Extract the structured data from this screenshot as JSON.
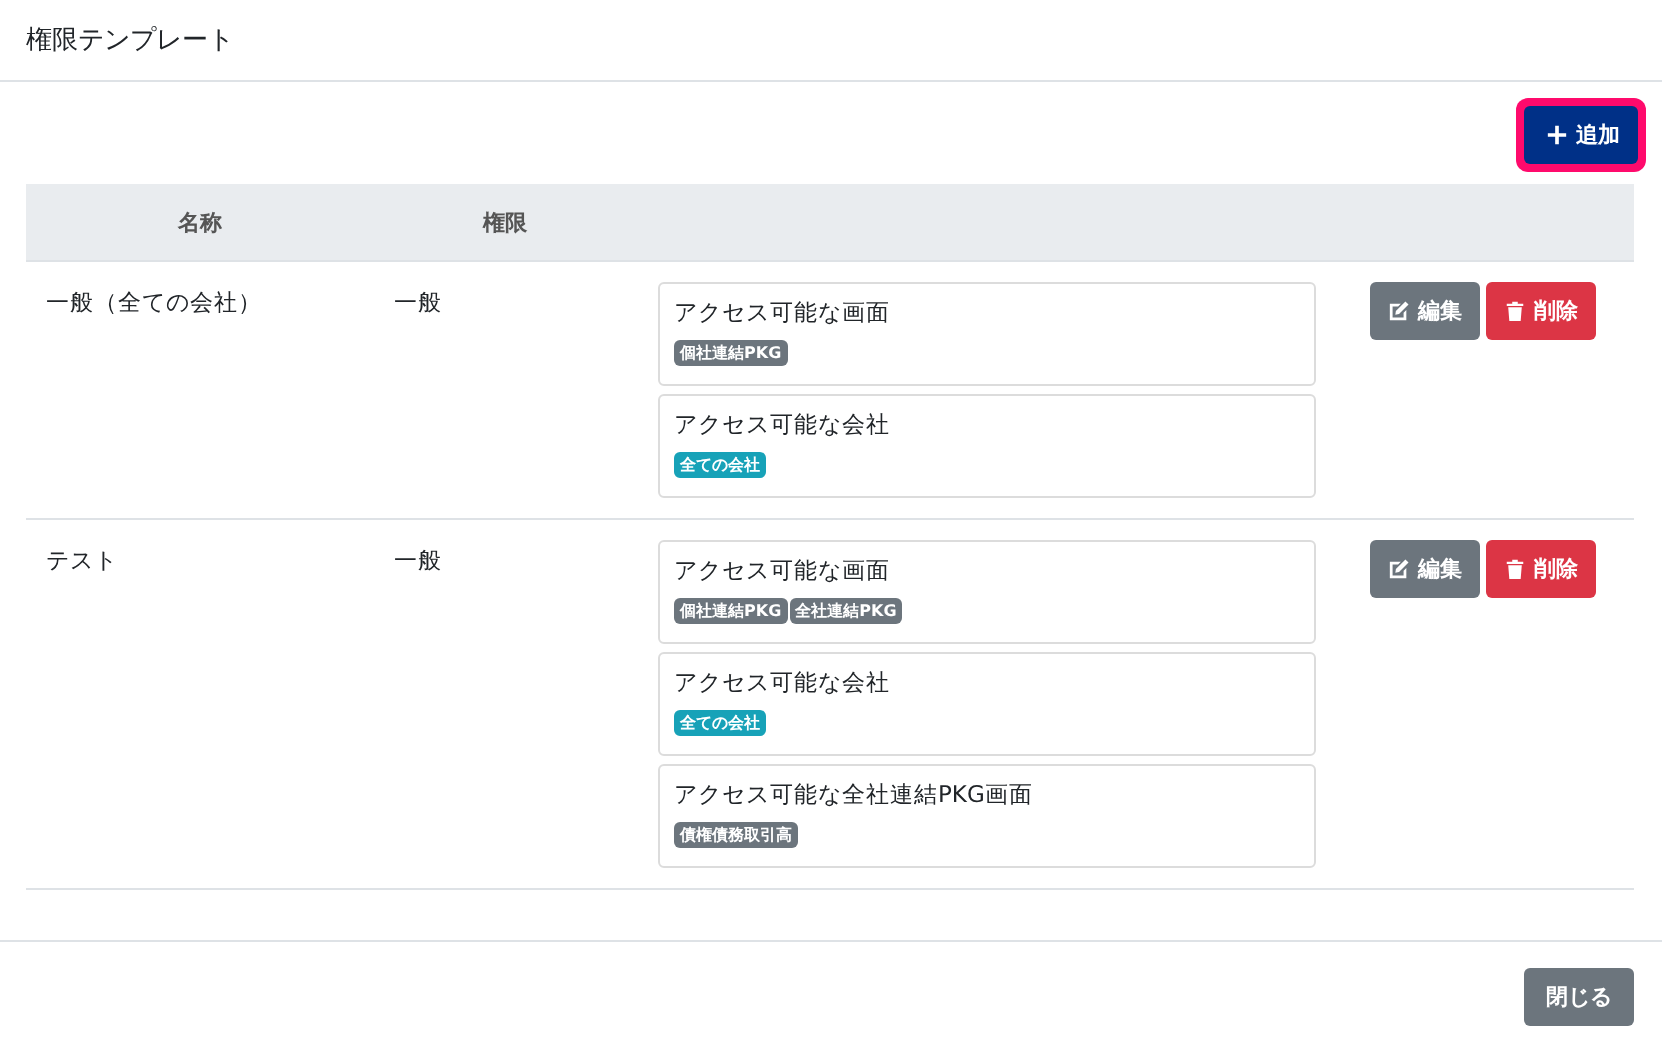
{
  "title": "権限テンプレート",
  "add_button": {
    "label": "追加",
    "highlighted": true
  },
  "table": {
    "columns": [
      "名称",
      "権限"
    ],
    "rows": [
      {
        "name": "一般（全ての会社）",
        "permission": "一般",
        "blocks": [
          {
            "title": "アクセス可能な画面",
            "tags": [
              {
                "label": "個社連結PKG",
                "color": "#6c757d"
              }
            ]
          },
          {
            "title": "アクセス可能な会社",
            "tags": [
              {
                "label": "全ての会社",
                "color": "#17a2b8"
              }
            ]
          }
        ],
        "actions": [
          {
            "kind": "edit",
            "label": "編集"
          },
          {
            "kind": "delete",
            "label": "削除"
          }
        ]
      },
      {
        "name": "テスト",
        "permission": "一般",
        "blocks": [
          {
            "title": "アクセス可能な画面",
            "tags": [
              {
                "label": "個社連結PKG",
                "color": "#6c757d"
              },
              {
                "label": "全社連結PKG",
                "color": "#6c757d"
              }
            ]
          },
          {
            "title": "アクセス可能な会社",
            "tags": [
              {
                "label": "全ての会社",
                "color": "#17a2b8"
              }
            ]
          },
          {
            "title": "アクセス可能な全社連結PKG画面",
            "tags": [
              {
                "label": "債権債務取引高",
                "color": "#6c757d"
              }
            ]
          }
        ],
        "actions": [
          {
            "kind": "edit",
            "label": "編集"
          },
          {
            "kind": "delete",
            "label": "削除"
          }
        ]
      }
    ]
  },
  "close_button": {
    "label": "閉じる"
  }
}
